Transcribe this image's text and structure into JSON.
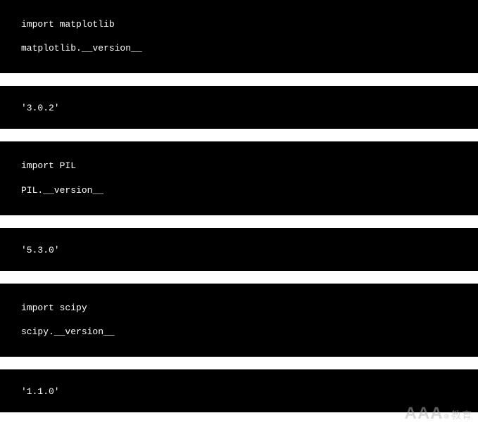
{
  "cells": [
    {
      "type": "code",
      "lines": [
        "import matplotlib",
        "matplotlib.__version__"
      ]
    },
    {
      "type": "output",
      "text": "'3.0.2'"
    },
    {
      "type": "code",
      "lines": [
        "import PIL",
        "PIL.__version__"
      ]
    },
    {
      "type": "output",
      "text": "'5.3.0'"
    },
    {
      "type": "code",
      "lines": [
        "import scipy",
        "scipy.__version__"
      ]
    },
    {
      "type": "output",
      "text": "'1.1.0'"
    }
  ],
  "watermark": {
    "main": "AAA",
    "reg": "®",
    "suffix": "教育"
  }
}
